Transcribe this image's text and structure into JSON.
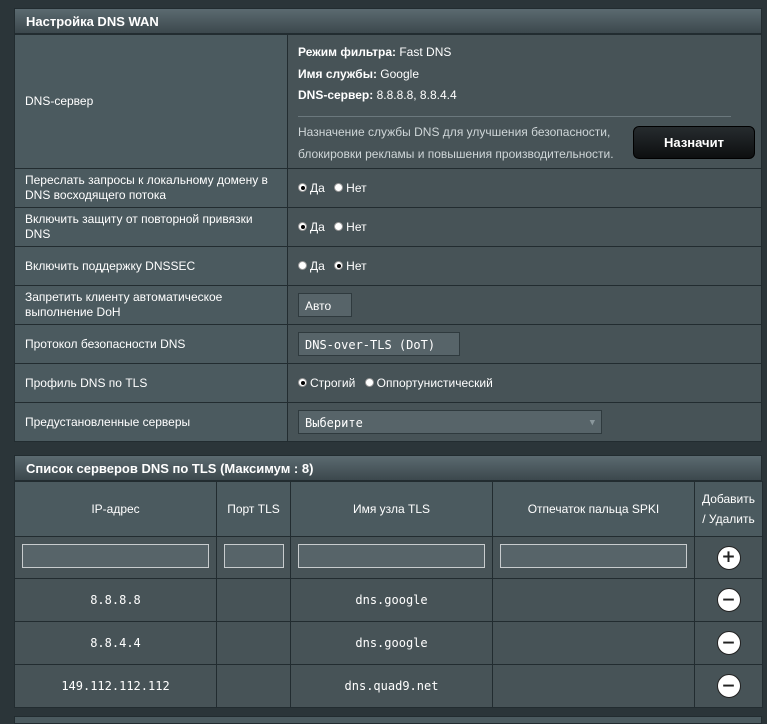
{
  "dns_wan": {
    "title": "Настройка DNS WAN",
    "dns_server": {
      "label": "DNS-сервер",
      "filter_mode_label": "Режим фильтра:",
      "filter_mode_value": " Fast DNS",
      "service_name_label": "Имя службы:",
      "service_name_value": " Google",
      "dns_server_label": "DNS-сервер:",
      "dns_server_value": " 8.8.8.8, 8.8.4.4",
      "description_line1": "Назначение службы DNS для улучшения безопасности,",
      "description_line2": "блокировки рекламы и повышения производительности.",
      "assign_button": "Назначит"
    },
    "rows": {
      "forward_local": {
        "label_line1": "Переслать запросы к локальному домену в",
        "label_line2": "DNS восходящего потока",
        "yes": "Да",
        "no": "Нет",
        "selected": "yes"
      },
      "rebind": {
        "label_line1": "Включить защиту от повторной привязки",
        "label_line2": "DNS",
        "yes": "Да",
        "no": "Нет",
        "selected": "yes"
      },
      "dnssec": {
        "label": "Включить поддержку DNSSEC",
        "yes": "Да",
        "no": "Нет",
        "selected": "no"
      },
      "doh": {
        "label_line1": "Запретить клиенту автоматическое",
        "label_line2": "выполнение DoH",
        "value": "Авто"
      },
      "protocol": {
        "label": "Протокол безопасности DNS",
        "value": "DNS-over-TLS (DoT)"
      },
      "tls_profile": {
        "label": "Профиль DNS по TLS",
        "strict": "Строгий",
        "opportunistic": "Оппортунистический",
        "selected": "strict"
      },
      "preset": {
        "label": "Предустановленные серверы",
        "value": "Выберите"
      }
    }
  },
  "tls_list": {
    "title": "Список серверов DNS по TLS (Максимум : 8)",
    "headers": {
      "ip": "IP-адрес",
      "port": "Порт TLS",
      "host": "Имя узла TLS",
      "spki": "Отпечаток пальца SPKI",
      "action_line1": "Добавить",
      "action_line2": "/ Удалить"
    },
    "entries": [
      {
        "ip": "8.8.8.8",
        "port": "",
        "host": "dns.google",
        "spki": ""
      },
      {
        "ip": "8.8.4.4",
        "port": "",
        "host": "dns.google",
        "spki": ""
      },
      {
        "ip": "149.112.112.112",
        "port": "",
        "host": "dns.quad9.net",
        "spki": ""
      }
    ],
    "add_icon": "plus-circle-icon",
    "remove_icon": "minus-circle-icon"
  }
}
